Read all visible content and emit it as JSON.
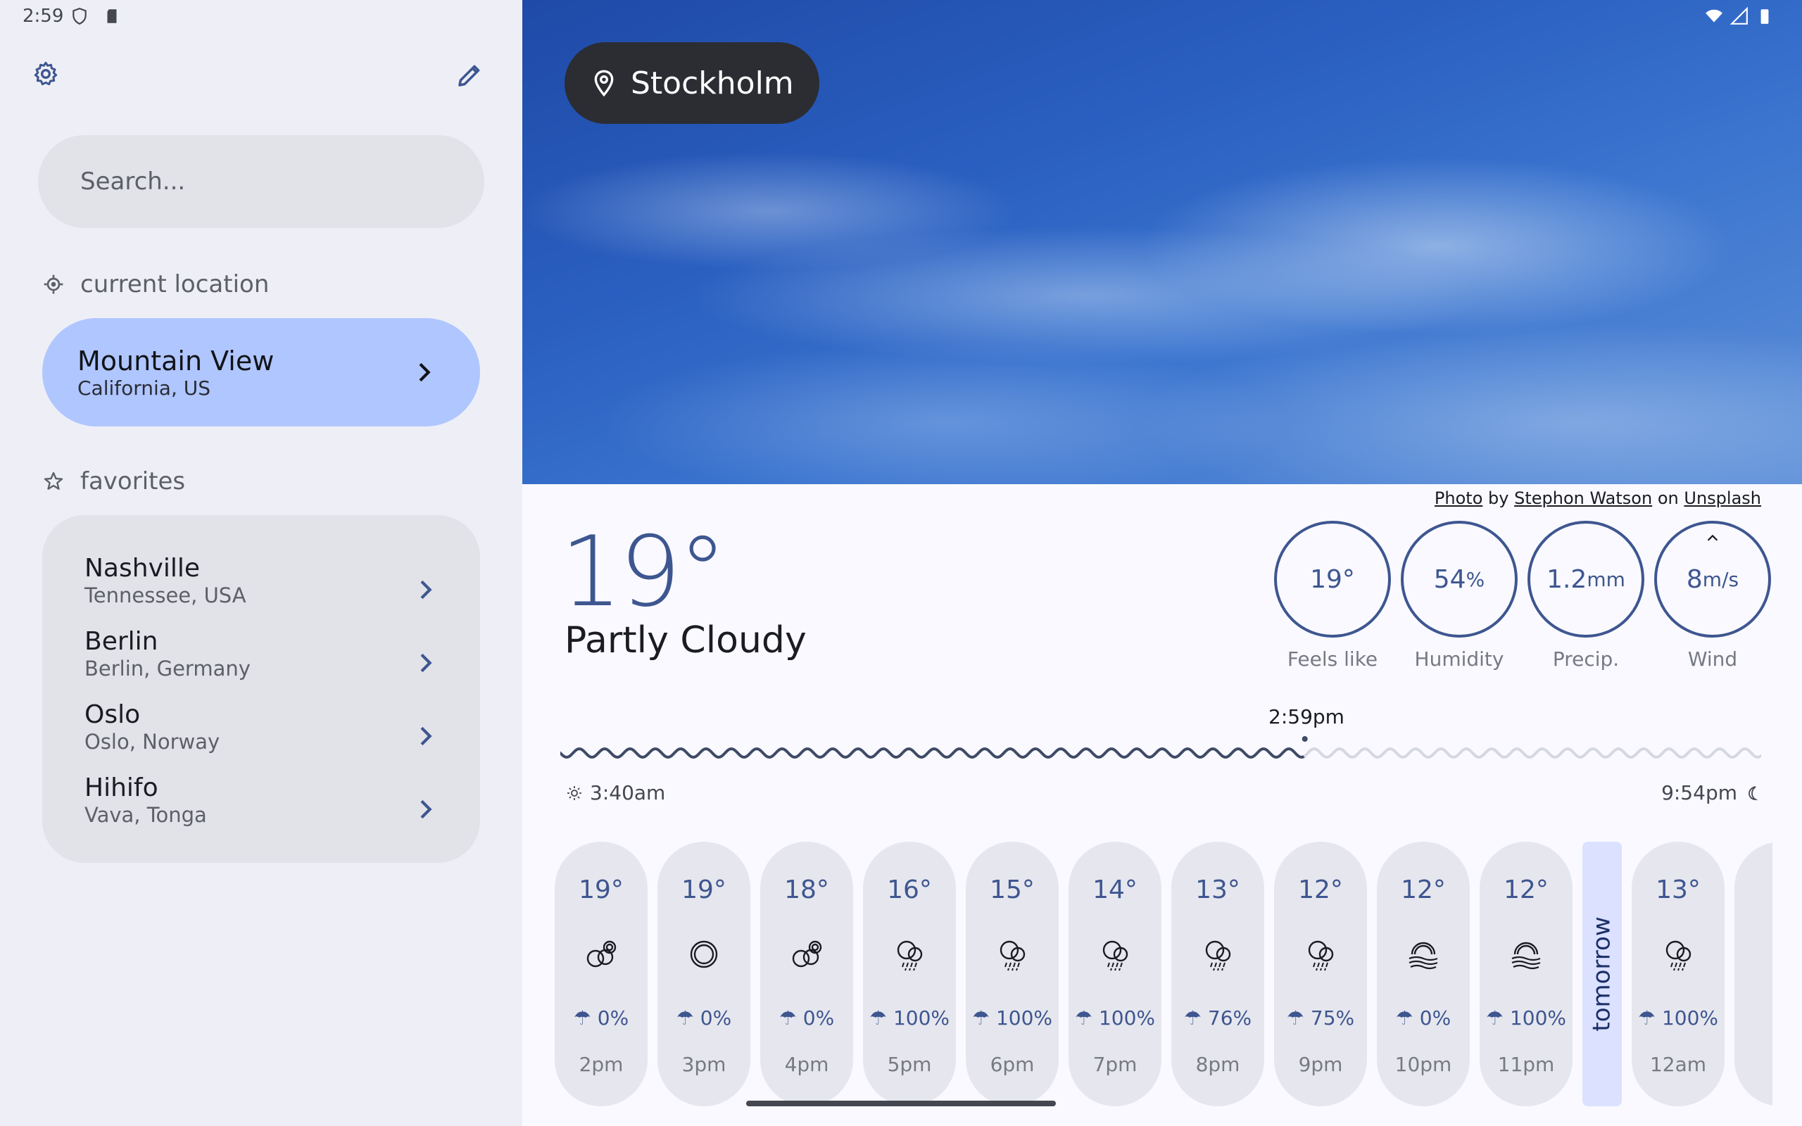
{
  "status": {
    "time": "2:59"
  },
  "sidebar": {
    "search_placeholder": "Search...",
    "current_location_label": "current location",
    "current_location": {
      "name": "Mountain View",
      "region": "California, US"
    },
    "favorites_label": "favorites",
    "favorites": [
      {
        "name": "Nashville",
        "region": "Tennessee, USA"
      },
      {
        "name": "Berlin",
        "region": "Berlin, Germany"
      },
      {
        "name": "Oslo",
        "region": "Oslo, Norway"
      },
      {
        "name": "Hihifo",
        "region": "Vava, Tonga"
      }
    ]
  },
  "hero": {
    "location": "Stockholm",
    "credit": {
      "photo": "Photo",
      "by": "by",
      "author": "Stephon Watson",
      "on": "on",
      "source": "Unsplash"
    }
  },
  "weather": {
    "temperature": "19°",
    "condition": "Partly Cloudy",
    "metrics": [
      {
        "value": "19°",
        "unit": "",
        "label": "Feels like"
      },
      {
        "value": "54",
        "unit": "%",
        "label": "Humidity"
      },
      {
        "value": "1.2",
        "unit": "mm",
        "label": "Precip."
      },
      {
        "value": "8",
        "unit": "m/s",
        "label": "Wind"
      }
    ],
    "now_time": "2:59pm",
    "daylight_progress": 0.62,
    "sunrise": "3:40am",
    "sunset": "9:54pm"
  },
  "hourly": [
    {
      "temp": "19°",
      "icon": "partly-cloudy-icon",
      "precip": "0%",
      "time": "2pm"
    },
    {
      "temp": "19°",
      "icon": "sun-icon",
      "precip": "0%",
      "time": "3pm"
    },
    {
      "temp": "18°",
      "icon": "partly-cloudy-icon",
      "precip": "0%",
      "time": "4pm"
    },
    {
      "temp": "16°",
      "icon": "rain-icon",
      "precip": "100%",
      "time": "5pm"
    },
    {
      "temp": "15°",
      "icon": "rain-icon",
      "precip": "100%",
      "time": "6pm"
    },
    {
      "temp": "14°",
      "icon": "rain-icon",
      "precip": "100%",
      "time": "7pm"
    },
    {
      "temp": "13°",
      "icon": "rain-icon",
      "precip": "76%",
      "time": "8pm"
    },
    {
      "temp": "12°",
      "icon": "rain-icon",
      "precip": "75%",
      "time": "9pm"
    },
    {
      "temp": "12°",
      "icon": "fog-icon",
      "precip": "0%",
      "time": "10pm"
    },
    {
      "temp": "12°",
      "icon": "fog-icon",
      "precip": "100%",
      "time": "11pm"
    },
    {
      "temp": "13°",
      "icon": "rain-icon",
      "precip": "100%",
      "time": "12am"
    }
  ],
  "tomorrow_label": "tomorrow",
  "colors": {
    "accent": "#3e5690",
    "selected_card": "#b0c6ff",
    "chip": "#2b2d33"
  }
}
